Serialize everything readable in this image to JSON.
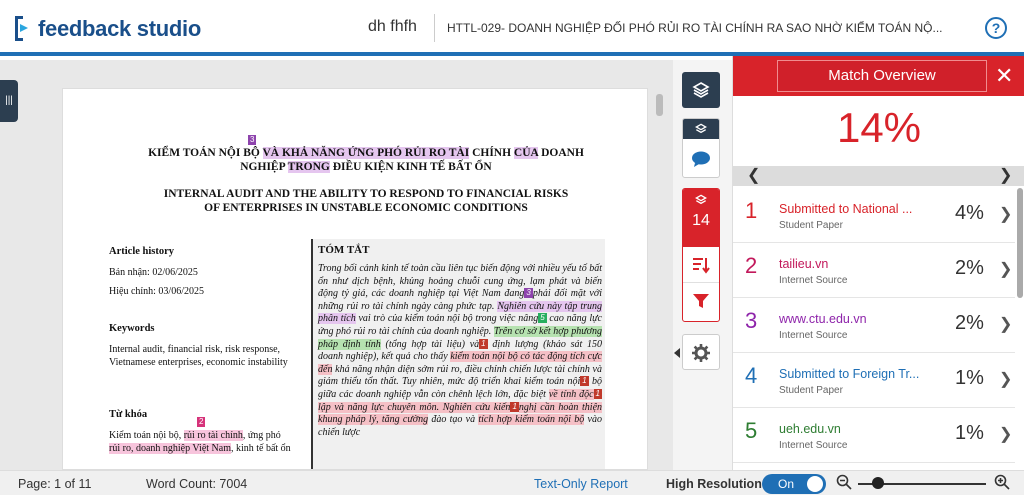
{
  "header": {
    "brand": "feedback studio",
    "user": "dh fhfh",
    "doc_title": "HTTL-029- DOANH NGHIỆP ĐỐI PHÓ RỦI RO TÀI CHÍNH RA SAO NHỜ KIỂM TOÁN NỘ...",
    "help": "?"
  },
  "document": {
    "title_vi_a": "KIỂM TOÁN NỘI BỘ ",
    "title_vi_b": "VÀ KHẢ NĂNG ỨNG PHÓ RỦI RO TÀI",
    "title_vi_c": " CHÍNH ",
    "title_vi_d": "CỦA",
    "title_vi_e": " DOANH",
    "title_vi_f": "NGHIỆP ",
    "title_vi_g": "TRONG",
    "title_vi_h": " ĐIỀU KIỆN KINH TẾ BẤT ỔN",
    "title_en_1": "INTERNAL AUDIT AND THE ABILITY TO RESPOND TO FINANCIAL RISKS",
    "title_en_2": "OF ENTERPRISES IN UNSTABLE ECONOMIC CONDITIONS",
    "badge_title": "3",
    "article_history": "Article history",
    "received": "Bản nhận: 02/06/2025",
    "revised": "Hiệu chỉnh: 03/06/2025",
    "keywords_heading": "Keywords",
    "keywords_text": "Internal audit, financial risk, risk response, Vietnamese enterprises, economic instability",
    "tukhoa_heading": "Từ khóa",
    "badge_tukhoa": "2",
    "tukhoa_a": "Kiểm toán nội bộ, ",
    "tukhoa_b": "rủi ro tài chính",
    "tukhoa_c": ", ứng phó ",
    "tukhoa_d": "rủi ro, doanh nghiệp Việt Nam",
    "tukhoa_e": ", kinh tế bất ổn",
    "tomtat_heading": "TÓM TẮT",
    "abs_1": "Trong bối cảnh kinh tế toàn cầu liên tục biến động với nhiều yếu tố bất ổn như dịch bệnh, khủng hoảng chuỗi cung ứng, lạm phát và biến động tỷ giá, các doanh nghiệp tại Việt Nam đang",
    "badge_abs_3": "3",
    "abs_2": "phải đối mặt với những rủi ro tài chính ngày càng phức tạp. ",
    "abs_3": "Nghiên cứu này tập trung phân tích",
    "abs_4": " vai trò của kiểm toán nội bộ trong việc nâng",
    "badge_abs_5": "5",
    "abs_5": " cao năng lực ứng phó rủi ro tài chính của doanh nghiệp. ",
    "abs_6": "Trên cơ sở kết hợp phương pháp định tính",
    "abs_7": " (tổng hợp tài liệu) và",
    "badge_abs_1a": "1",
    "abs_8": " định lượng (khảo sát 150 doanh nghiệp), kết quả cho thấy ",
    "abs_9": "kiểm toán nội bộ có tác động tích cực đến",
    "abs_10": " khả năng nhận diện sớm rủi ro, điều chỉnh chiến lược tài chính và giảm thiểu tổn thất. Tuy nhiên, mức độ triển khai kiểm toán nội",
    "badge_abs_1b": "1",
    "abs_11": " bộ giữa các doanh nghiệp vẫn còn chênh lệch lớn, đặc biệt ",
    "abs_12": "về tính độc",
    "badge_abs_1c": "1",
    "abs_13": " lập và năng lực chuyên môn. Nghiên cứu kiến",
    "badge_abs_1d": "1",
    "abs_14": "nghị cần hoàn thiện khung pháp lý, tăng cường",
    "abs_15": " đào tạo và ",
    "abs_16": "tích hợp kiểm toán nội bộ",
    "abs_17": " vào chiến lược"
  },
  "toolbar": {
    "layers_icon": "layers-icon",
    "match_count": "14"
  },
  "panel": {
    "title": "Match Overview",
    "close": "✕",
    "overall_percent": "14%",
    "matches": [
      {
        "num": "1",
        "source": "Submitted to National ...",
        "type": "Student Paper",
        "percent": "4%",
        "color": "#d8232a"
      },
      {
        "num": "2",
        "source": "tailieu.vn",
        "type": "Internet Source",
        "percent": "2%",
        "color": "#c2185b"
      },
      {
        "num": "3",
        "source": "www.ctu.edu.vn",
        "type": "Internet Source",
        "percent": "2%",
        "color": "#8e24aa"
      },
      {
        "num": "4",
        "source": "Submitted to Foreign Tr...",
        "type": "Student Paper",
        "percent": "1%",
        "color": "#1f6fb5"
      },
      {
        "num": "5",
        "source": "ueh.edu.vn",
        "type": "Internet Source",
        "percent": "1%",
        "color": "#2e7d32"
      }
    ]
  },
  "status": {
    "page": "Page: 1 of 11",
    "word_count": "Word Count: 7004",
    "text_only": "Text-Only Report",
    "high_res": "High Resolution",
    "toggle": "On"
  }
}
